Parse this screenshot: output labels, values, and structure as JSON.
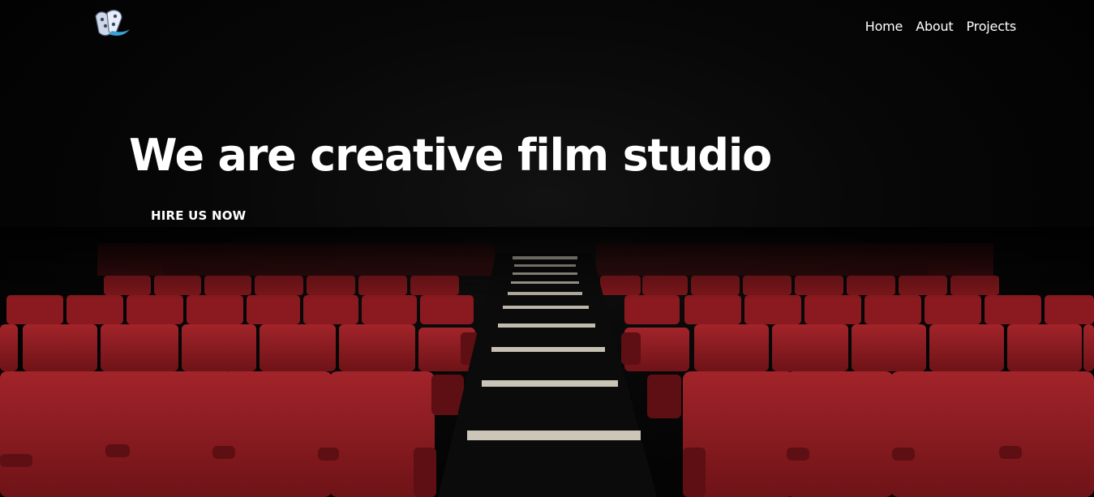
{
  "nav": {
    "logo_icon": "film-reel-logo-icon",
    "links": [
      {
        "label": "Home"
      },
      {
        "label": "About"
      },
      {
        "label": "Projects"
      }
    ]
  },
  "hero": {
    "headline": "We are creative film studio",
    "cta_label": "HIRE US NOW",
    "background": "cinema-red-seats-image"
  },
  "colors": {
    "background": "#000000",
    "text": "#ffffff",
    "seat_red": "#8e1b20",
    "step_edge": "#c9c2b4"
  }
}
